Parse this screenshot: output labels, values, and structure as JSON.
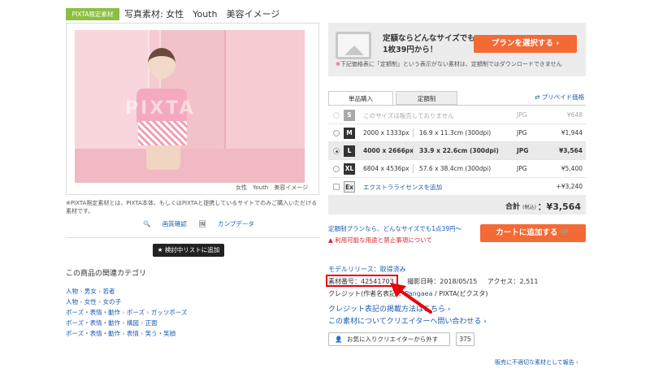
{
  "header": {
    "badge": "PIXTA限定素材",
    "title": "写真素材: 女性　Youth　美容イメージ"
  },
  "image": {
    "watermark": "PIXTA",
    "caption": "女性　Youth　美容イメージ"
  },
  "note": "※PIXTA限定素材とは、PIXTA本体、もしくはPIXTAと提携しているサイトでのみご購入いただける素材です。",
  "actions": {
    "preview": "画質確認",
    "camera_data": "カンプデータ"
  },
  "wishlist_button": "検討中リストに追加",
  "categories": {
    "title": "この商品の関連カテゴリ",
    "rows": [
      [
        "人物",
        "男女",
        "若者"
      ],
      [
        "人物",
        "女性",
        "女の子"
      ],
      [
        "ポーズ・表情・動作",
        "ポーズ",
        "ガッツポーズ"
      ],
      [
        "ポーズ・表情・動作",
        "構図",
        "正面"
      ],
      [
        "ポーズ・表情・動作",
        "表情",
        "笑う・笑顔"
      ]
    ]
  },
  "subscription": {
    "line1": "定額ならどんなサイズでも",
    "line2": "1枚39円から！",
    "plan_button": "プランを選択する",
    "note_prefix": "※",
    "note": "下記価格表に「定額制」という表示がない素材は、定額制ではダウンロードできません"
  },
  "tabs": {
    "single": "単品購入",
    "subscription": "定額制",
    "prepaid": "プリペイド価格"
  },
  "sizes": [
    {
      "code": "S",
      "desc": "このサイズは販売しておりません",
      "format": "JPG",
      "price": "¥648",
      "state": "disabled"
    },
    {
      "code": "M",
      "px": "2000 x 1333px",
      "cm": "16.9 x 11.3cm (300dpi)",
      "format": "JPG",
      "price": "¥1,944",
      "state": "normal"
    },
    {
      "code": "L",
      "px": "4000 x 2666px",
      "cm": "33.9 x 22.6cm (300dpi)",
      "format": "JPG",
      "price": "¥3,564",
      "state": "selected"
    },
    {
      "code": "XL",
      "px": "6804 x 4536px",
      "cm": "57.6 x 38.4cm (300dpi)",
      "format": "JPG",
      "price": "¥5,400",
      "state": "normal"
    }
  ],
  "extra_license": {
    "code": "Ex",
    "label": "エクストラライセンスを追加",
    "price": "+¥3,240"
  },
  "total": {
    "label": "合計",
    "tax": "(税込)",
    "amount": "：¥3,564"
  },
  "subscription_link": "定額制プランなら、どんなサイズでも1点39円～",
  "warning": "利用可能な用途と禁止事項について",
  "cart_button": "カートに追加する",
  "meta": {
    "model_release": "モデルリリース：取得済み",
    "material_id": "素材番号：42541703",
    "shot_date": "撮影日時：2018/05/15",
    "access": "アクセス：2,511",
    "credit_label": "クレジット(作者名表記)：",
    "credit_author": "Pangaea",
    "credit_site": "/ PIXTA(ピクスタ)"
  },
  "links": {
    "credit_examples": "クレジット表記の掲載方法はこちら ›",
    "contact_creator": "この素材についてクリエイターへ問い合わせる ›"
  },
  "favorite": {
    "label": "お気に入りクリエイターから外す",
    "count": "375"
  },
  "report": "販売に不適切な素材として報告 ›",
  "colors": {
    "badge": "#8cbf3f",
    "accent": "#f26a36",
    "link": "#1a5cb4",
    "warning": "#d9232a",
    "highlight_box": "#e8000b"
  }
}
